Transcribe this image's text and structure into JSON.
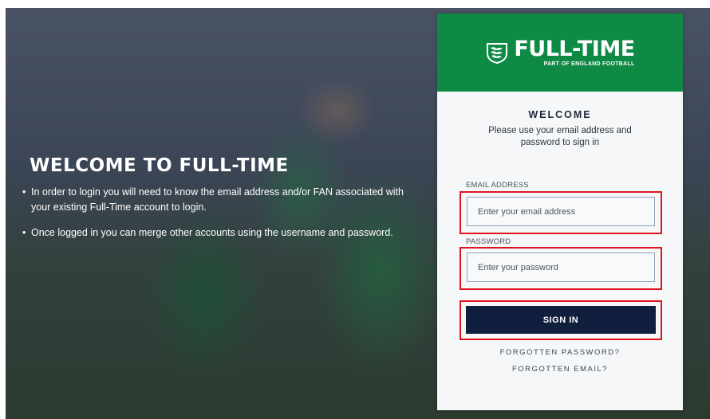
{
  "hero": {
    "title": "WELCOME TO FULL-TIME",
    "bullets": [
      "In order to login you will need to know the email address and/or FAN associated with your existing Full-Time account to login.",
      "Once logged in you can merge other accounts using the username and password."
    ],
    "bullet_char": "•"
  },
  "brand": {
    "name": "FULL-TIME",
    "tagline": "PART OF ENGLAND FOOTBALL",
    "header_color": "#0f8a45",
    "button_color": "#0f1f3d",
    "highlight_color": "#e0141e"
  },
  "login": {
    "welcome_title": "WELCOME",
    "welcome_text": "Please use your email address and password to sign in",
    "email_label": "EMAIL ADDRESS",
    "email_placeholder": "Enter your email address",
    "email_value": "",
    "password_label": "PASSWORD",
    "password_placeholder": "Enter your password",
    "password_value": "",
    "signin_label": "SIGN IN",
    "forgot_password": "FORGOTTEN PASSWORD?",
    "forgot_email": "FORGOTTEN EMAIL?"
  }
}
